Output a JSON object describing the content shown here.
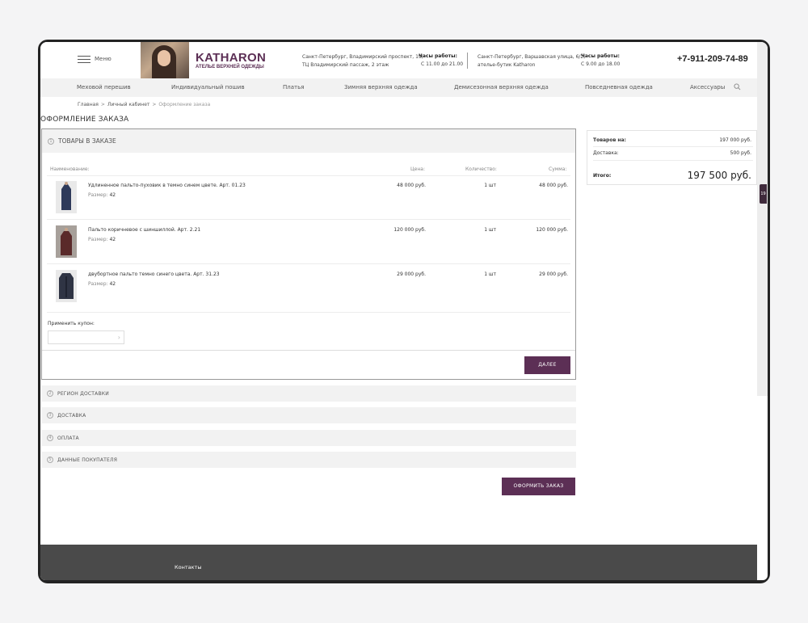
{
  "header": {
    "menu_label": "Меню",
    "logo_title": "KATHARON",
    "logo_subtitle": "АТЕЛЬЕ ВЕРХНЕЙ ОДЕЖДЫ",
    "address1_line1": "Санкт-Петербург, Владимирский проспект, 19,",
    "address1_line2": "ТЦ Владимирский пассаж, 2 этаж",
    "hours1_title": "Часы работы:",
    "hours1_value": "С 11.00 до 21.00",
    "address2_line1": "Санкт-Петербург, Варшавская улица, 6/2,",
    "address2_line2": "ателье-бутик Katharon",
    "hours2_title": "Часы работы:",
    "hours2_value": "С 9.00 до 18.00",
    "phone": "+7-911-209-74-89"
  },
  "nav": {
    "items": [
      "Меховой перешив",
      "Индивидуальный пошив",
      "Платья",
      "Зимняя верхняя одежда",
      "Демисезонная верхняя одежда",
      "Повседневная одежда",
      "Аксессуары"
    ],
    "search_icon": "search-icon"
  },
  "breadcrumb": {
    "items": [
      "Главная",
      "Личный кабинет",
      "Оформление заказа"
    ],
    "separator": ">"
  },
  "page_title": "ОФОРМЛЕНИЕ ЗАКАЗА",
  "order": {
    "section_number": "1",
    "title": "ТОВАРЫ В ЗАКАЗЕ",
    "columns": {
      "name": "Наименование:",
      "price": "Цена:",
      "qty": "Количество:",
      "sum": "Сумма:"
    },
    "size_label": "Размер:",
    "items": [
      {
        "name": "Удлиненное пальто-пуховик в темно синем цвете. Арт. 01.23",
        "size": "42",
        "price": "48 000 руб.",
        "qty": "1 шт",
        "sum": "48 000 руб.",
        "color": "#2e3a5a"
      },
      {
        "name": "Пальто коричневое с шиншиллой. Арт. 2.21",
        "size": "42",
        "price": "120 000 руб.",
        "qty": "1 шт",
        "sum": "120 000 руб.",
        "color": "#5a2a2a"
      },
      {
        "name": "двубортное пальто темно синего цвета. Арт. 31.23",
        "size": "42",
        "price": "29 000 руб.",
        "qty": "1 шт",
        "sum": "29 000 руб.",
        "color": "#2f3444"
      }
    ],
    "coupon_label": "Применить купон:",
    "coupon_placeholder": "",
    "next_button": "ДАЛЕЕ"
  },
  "sections": [
    {
      "number": "2",
      "title": "РЕГИОН ДОСТАВКИ"
    },
    {
      "number": "3",
      "title": "ДОСТАВКА"
    },
    {
      "number": "4",
      "title": "ОПЛАТА"
    },
    {
      "number": "5",
      "title": "ДАННЫЕ ПОКУПАТЕЛЯ"
    }
  ],
  "place_order_button": "ОФОРМИТЬ ЗАКАЗ",
  "summary": {
    "goods_label": "Товаров на:",
    "goods_value": "197 000 руб.",
    "delivery_label": "Доставка:",
    "delivery_value": "500 руб.",
    "total_label": "Итого:",
    "total_value": "197 500 руб."
  },
  "side_tab_label": "19",
  "footer": {
    "contacts_link": "Контакты"
  },
  "colors": {
    "accent": "#5c2f55",
    "footer": "#4a4a4a",
    "frame": "#232323"
  }
}
